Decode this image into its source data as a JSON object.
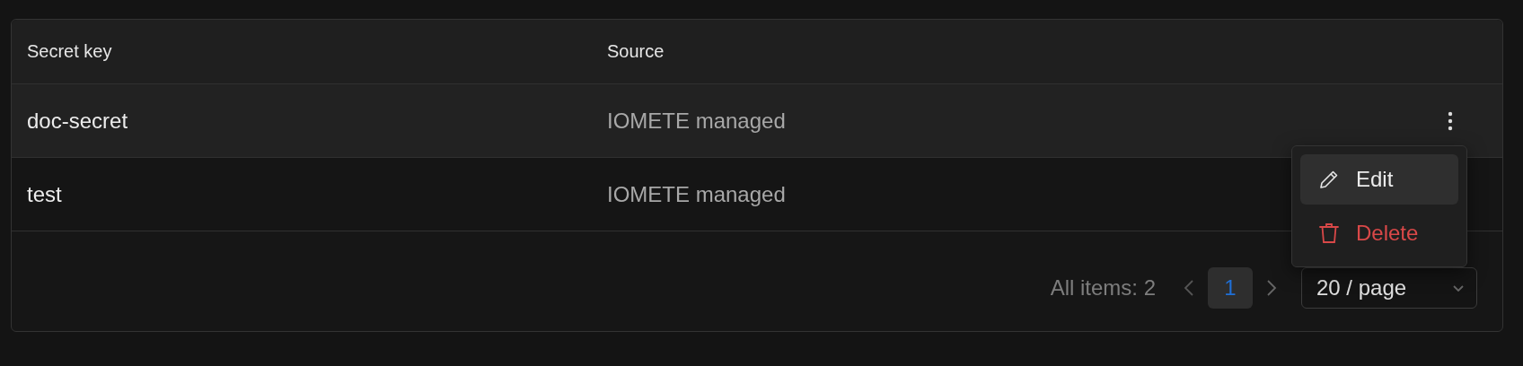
{
  "table": {
    "columns": [
      "Secret key",
      "Source"
    ],
    "rows": [
      {
        "key": "doc-secret",
        "source": "IOMETE managed",
        "hovered": true
      },
      {
        "key": "test",
        "source": "IOMETE managed",
        "hovered": false
      }
    ]
  },
  "row_menu": {
    "items": [
      {
        "kind": "edit",
        "label": "Edit",
        "selected": true
      },
      {
        "kind": "delete",
        "label": "Delete",
        "selected": false
      }
    ]
  },
  "pagination": {
    "total": "All items: 2",
    "pages": [
      {
        "label": "1",
        "selected": true
      }
    ],
    "page_size": "20 / page"
  }
}
